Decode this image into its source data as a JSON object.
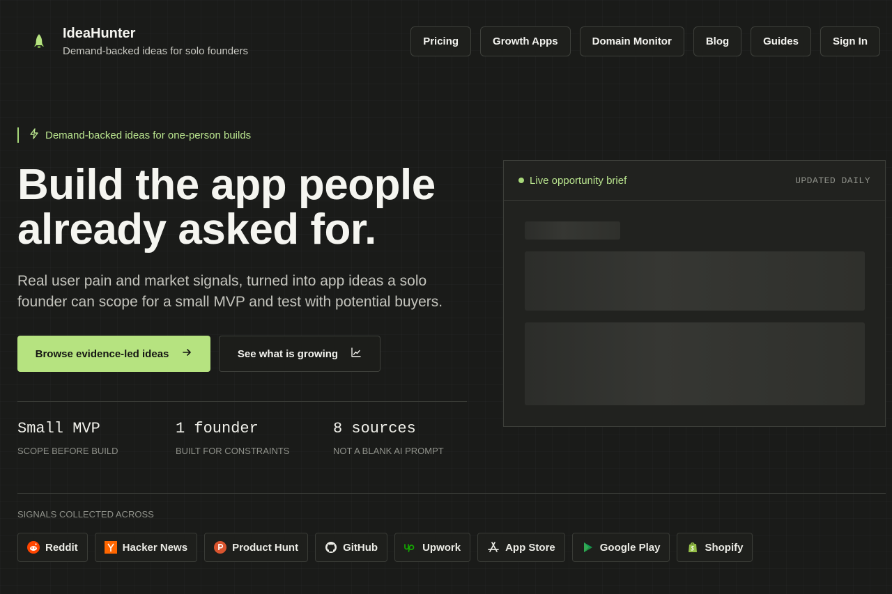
{
  "header": {
    "brand_name": "IdeaHunter",
    "brand_tagline": "Demand-backed ideas for solo founders",
    "nav": [
      {
        "label": "Pricing"
      },
      {
        "label": "Growth Apps"
      },
      {
        "label": "Domain Monitor"
      },
      {
        "label": "Blog"
      },
      {
        "label": "Guides"
      },
      {
        "label": "Sign In"
      }
    ]
  },
  "hero": {
    "eyebrow": "Demand-backed ideas for one-person builds",
    "title": "Build the app people already asked for.",
    "subtitle": "Real user pain and market signals, turned into app ideas a solo founder can scope for a small MVP and test with potential buyers.",
    "cta_primary": "Browse evidence-led ideas",
    "cta_secondary": "See what is growing"
  },
  "stats": [
    {
      "value": "Small MVP",
      "label": "SCOPE BEFORE BUILD"
    },
    {
      "value": "1 founder",
      "label": "BUILT FOR CONSTRAINTS"
    },
    {
      "value": "8 sources",
      "label": "NOT A BLANK AI PROMPT"
    }
  ],
  "brief": {
    "live_label": "Live opportunity brief",
    "updated_label": "UPDATED DAILY"
  },
  "signals": {
    "label": "SIGNALS COLLECTED ACROSS",
    "sources": [
      {
        "label": "Reddit",
        "icon": "reddit-icon"
      },
      {
        "label": "Hacker News",
        "icon": "hacker-news-icon"
      },
      {
        "label": "Product Hunt",
        "icon": "product-hunt-icon"
      },
      {
        "label": "GitHub",
        "icon": "github-icon"
      },
      {
        "label": "Upwork",
        "icon": "upwork-icon"
      },
      {
        "label": "App Store",
        "icon": "app-store-icon"
      },
      {
        "label": "Google Play",
        "icon": "google-play-icon"
      },
      {
        "label": "Shopify",
        "icon": "shopify-icon"
      }
    ]
  },
  "colors": {
    "accent": "#b6e380",
    "background": "#1a1b19"
  }
}
